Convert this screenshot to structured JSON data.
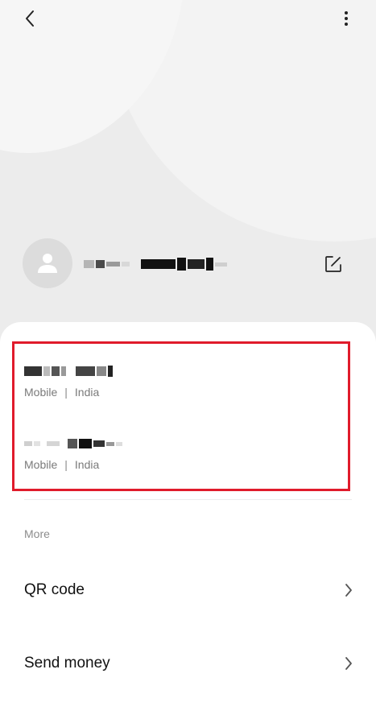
{
  "header": {
    "back_icon": "chevron-left-icon",
    "more_icon": "more-vertical-icon"
  },
  "profile": {
    "avatar_icon": "person-icon",
    "edit_icon": "edit-icon"
  },
  "numbers": [
    {
      "type": "Mobile",
      "separator": "|",
      "country": "India"
    },
    {
      "type": "Mobile",
      "separator": "|",
      "country": "India"
    }
  ],
  "more": {
    "label": "More",
    "items": [
      {
        "label": "QR code",
        "icon": "chevron-right-icon"
      },
      {
        "label": "Send money",
        "icon": "chevron-right-icon"
      }
    ]
  },
  "colors": {
    "highlight": "#e01b2b",
    "background": "#ececec",
    "sheet": "#ffffff",
    "muted": "#7a7a7a"
  }
}
